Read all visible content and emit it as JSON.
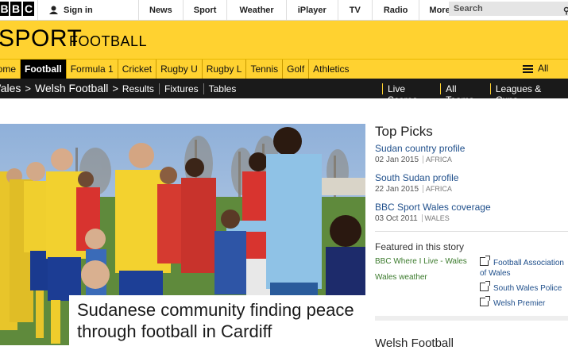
{
  "topbar": {
    "logo_letters": [
      "B",
      "B",
      "C"
    ],
    "signin": "Sign in",
    "nav": [
      "News",
      "Sport",
      "Weather",
      "iPlayer",
      "TV",
      "Radio",
      "More…"
    ],
    "search_placeholder": "Search"
  },
  "banner": {
    "sport": "SPORT",
    "section": "FOOTBALL",
    "color": "#ffd230"
  },
  "subnav": {
    "items": [
      "Home",
      "Football",
      "Formula 1",
      "Cricket",
      "Rugby U",
      "Rugby L",
      "Tennis",
      "Golf",
      "Athletics"
    ],
    "active": "Football",
    "all_sport": "All Sport"
  },
  "crumbs": {
    "path": [
      "Wales",
      "Welsh Football"
    ],
    "links": [
      "Results",
      "Fixtures",
      "Tables"
    ],
    "right": [
      "Live Scores",
      "All Teams",
      "Leagues & Cups"
    ]
  },
  "hero": {
    "headline": "Sudanese community finding peace through football in Cardiff"
  },
  "top_picks": {
    "heading": "Top Picks",
    "items": [
      {
        "title": "Sudan country profile",
        "date": "02 Jan 2015",
        "tag": "AFRICA"
      },
      {
        "title": "South Sudan profile",
        "date": "22 Jan 2015",
        "tag": "AFRICA"
      },
      {
        "title": "BBC Sport Wales coverage",
        "date": "03 Oct 2011",
        "tag": "WALES"
      }
    ]
  },
  "featured": {
    "heading": "Featured in this story",
    "internal": [
      "BBC Where I Live - Wales",
      "Wales weather"
    ],
    "external": [
      "Football Association of Wales",
      "South Wales Police",
      "Welsh Premier"
    ]
  },
  "welsh_football_heading": "Welsh Football"
}
